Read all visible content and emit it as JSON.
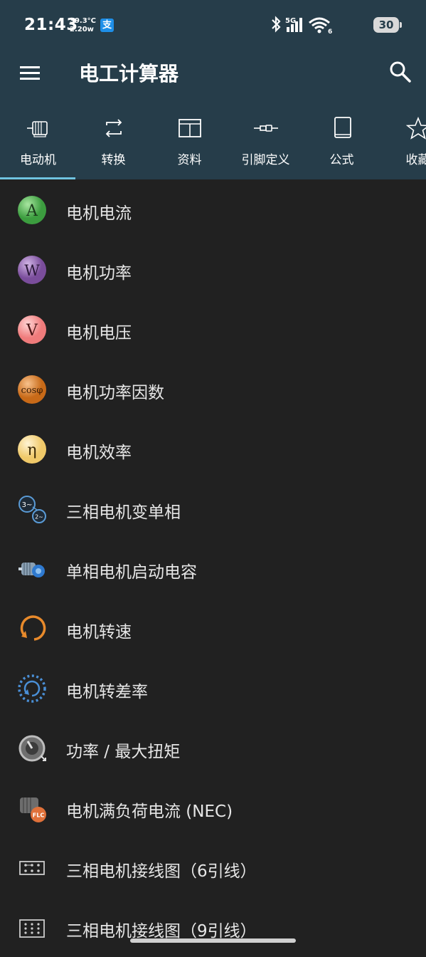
{
  "status_bar": {
    "time": "21:43",
    "temp": "39.3°C",
    "speed": "2.20w",
    "alipay_glyph": "支",
    "network": "5G",
    "wifi_sub": "6",
    "battery": "30"
  },
  "app_bar": {
    "title": "电工计算器"
  },
  "tabs": [
    {
      "label": "电动机",
      "icon": "motor-icon"
    },
    {
      "label": "转换",
      "icon": "convert-icon"
    },
    {
      "label": "资料",
      "icon": "table-icon"
    },
    {
      "label": "引脚定义",
      "icon": "cable-icon"
    },
    {
      "label": "公式",
      "icon": "book-icon"
    },
    {
      "label": "收藏",
      "icon": "star-icon"
    }
  ],
  "list_items": [
    {
      "label": "电机电流",
      "icon": "current-a-icon",
      "glyph": "A",
      "color": "#4cae4f"
    },
    {
      "label": "电机功率",
      "icon": "power-w-icon",
      "glyph": "W",
      "color": "#8e5fad"
    },
    {
      "label": "电机电压",
      "icon": "voltage-v-icon",
      "glyph": "V",
      "color": "#f28b8b"
    },
    {
      "label": "电机功率因数",
      "icon": "cos-phi-icon",
      "glyph": "cosφ",
      "color": "#d8781f"
    },
    {
      "label": "电机效率",
      "icon": "efficiency-eta-icon",
      "glyph": "η",
      "color": "#f5d88a"
    },
    {
      "label": "三相电机变单相",
      "icon": "phase-convert-icon",
      "glyph": "3~",
      "glyph2": "2~",
      "color": "#5a9bd6"
    },
    {
      "label": "单相电机启动电容",
      "icon": "motor-capacitor-icon",
      "color": "#4a8fd6"
    },
    {
      "label": "电机转速",
      "icon": "rotation-arrow-icon",
      "color": "#e88a2b"
    },
    {
      "label": "电机转差率",
      "icon": "dotted-rotation-icon",
      "color": "#4a8fd6"
    },
    {
      "label": "功率 / 最大扭矩",
      "icon": "torque-icon",
      "color": "#b0b0b0"
    },
    {
      "label": "电机满负荷电流 (NEC)",
      "icon": "flc-motor-icon",
      "glyph": "FLC",
      "color": "#e0713a"
    },
    {
      "label": "三相电机接线图（6引线）",
      "icon": "wiring-6-icon",
      "color": "#cccccc"
    },
    {
      "label": "三相电机接线图（9引线）",
      "icon": "wiring-9-icon",
      "color": "#cccccc"
    }
  ]
}
